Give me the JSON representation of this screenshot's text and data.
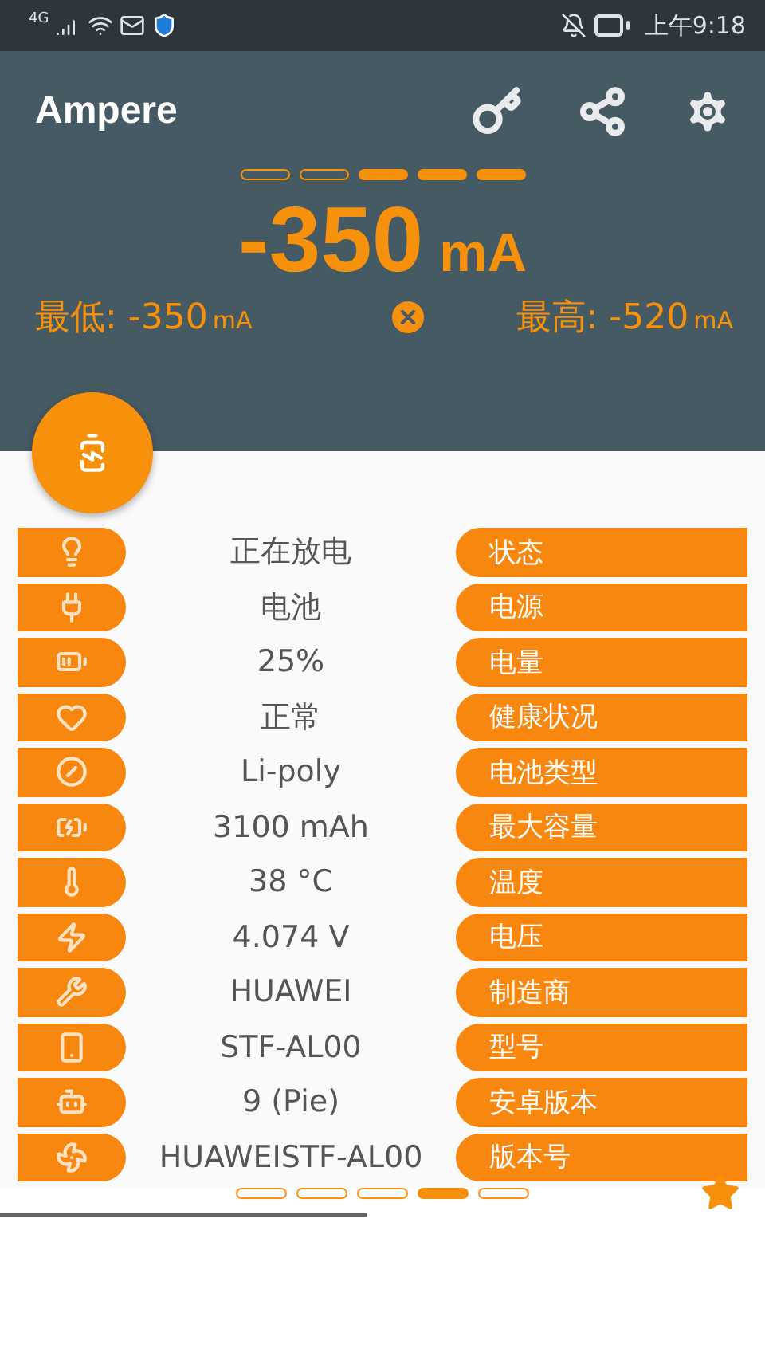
{
  "status_bar": {
    "network": "4G",
    "time": "上午9:18"
  },
  "app_bar": {
    "title": "Ampere"
  },
  "meter": {
    "segments": [
      {
        "filled": false
      },
      {
        "filled": false
      },
      {
        "filled": true
      },
      {
        "filled": true
      },
      {
        "filled": true
      }
    ],
    "current": "-350",
    "unit": "mA",
    "min": {
      "label": "最低: -350",
      "unit": "mA"
    },
    "max": {
      "label": "最高: -520",
      "unit": "mA"
    }
  },
  "info_rows": [
    {
      "value": "正在放电",
      "label": "状态"
    },
    {
      "value": "电池",
      "label": "电源"
    },
    {
      "value": "25%",
      "label": "电量"
    },
    {
      "value": "正常",
      "label": "健康状况"
    },
    {
      "value": "Li-poly",
      "label": "电池类型"
    },
    {
      "value": "3100 mAh",
      "label": "最大容量"
    },
    {
      "value": "38 °C",
      "label": "温度"
    },
    {
      "value": "4.074 V",
      "label": "电压"
    },
    {
      "value": "HUAWEI",
      "label": "制造商"
    },
    {
      "value": "STF-AL00",
      "label": "型号"
    },
    {
      "value": "9 (Pie)",
      "label": "安卓版本"
    },
    {
      "value": "HUAWEISTF-AL00",
      "label": "版本号"
    }
  ],
  "pager": [
    {
      "selected": false
    },
    {
      "selected": false
    },
    {
      "selected": false
    },
    {
      "selected": true
    },
    {
      "selected": false
    }
  ]
}
